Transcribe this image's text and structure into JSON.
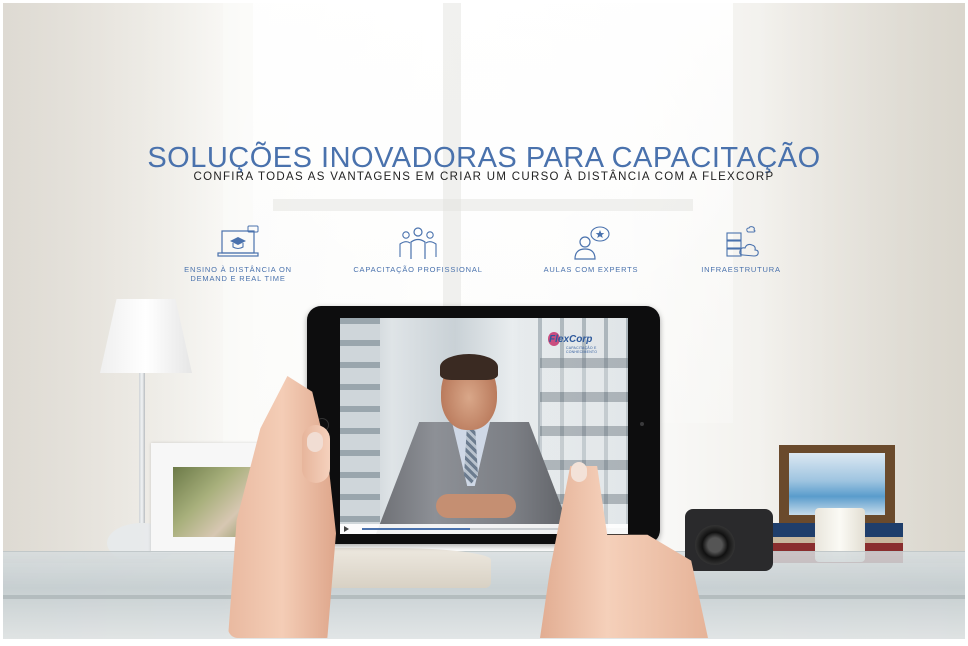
{
  "hero": {
    "title": "SOLUÇÕES INOVADORAS PARA CAPACITAÇÃO",
    "subtitle": "CONFIRA TODAS AS VANTAGENS EM CRIAR UM CURSO À DISTÂNCIA COM A FLEXCORP"
  },
  "features": [
    {
      "label": "ENSINO À DISTÂNCIA ON DEMAND E REAL TIME",
      "icon": "laptop-graduation-icon"
    },
    {
      "label": "CAPACITAÇÃO PROFISSIONAL",
      "icon": "professionals-group-icon"
    },
    {
      "label": "AULAS COM EXPERTS",
      "icon": "expert-star-icon"
    },
    {
      "label": "INFRAESTRUTURA",
      "icon": "server-cloud-icon"
    }
  ],
  "tablet": {
    "logo_text": "FlexCorp",
    "logo_tagline": "CAPACITAÇÃO E CONHECIMENTO",
    "video_progress": 0.45
  },
  "colors": {
    "accent": "#4a72ad",
    "text_dark": "#222222"
  }
}
